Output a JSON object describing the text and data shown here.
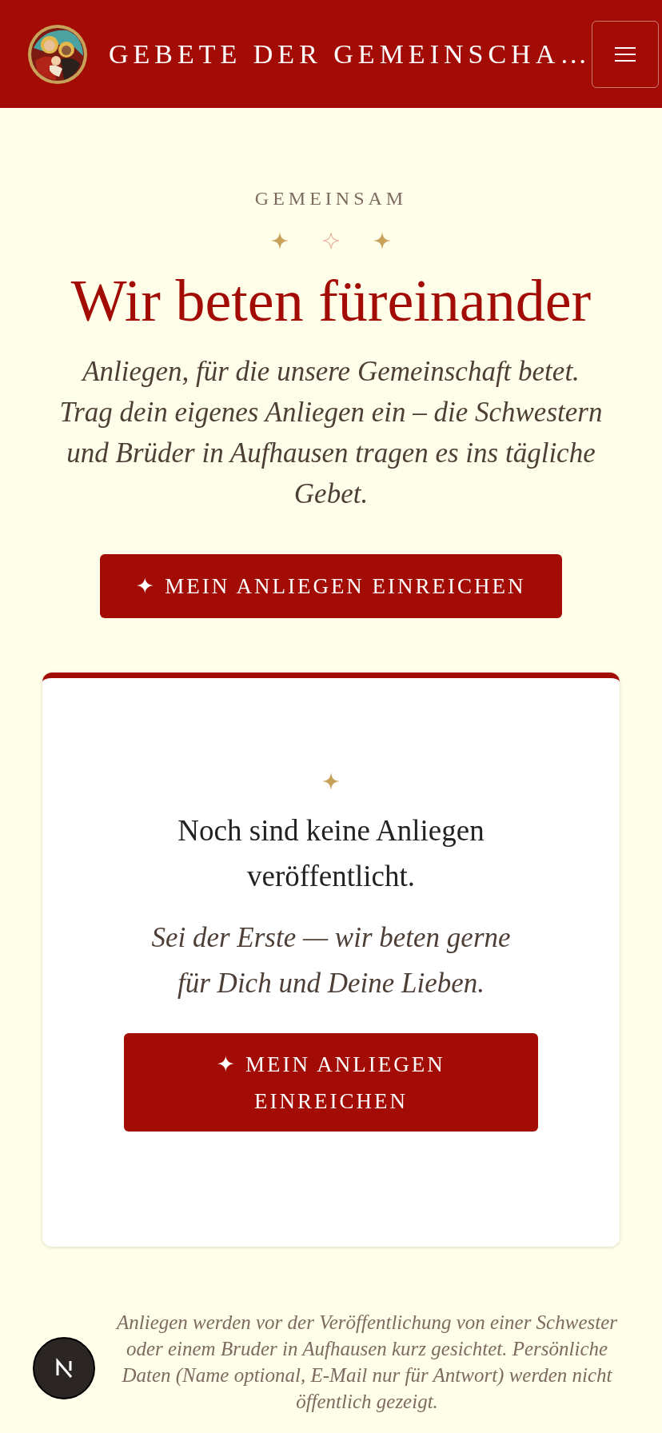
{
  "header": {
    "title": "GEBETE DER GEMEINSCHA…"
  },
  "intro": {
    "eyebrow": "GEMEINSAM",
    "title": "Wir beten füreinander",
    "text": "Anliegen, für die unsere Gemeinschaft betet. Trag dein eigenes Anliegen ein – die Schwestern und Brüder in Aufhausen tragen es ins tägliche Gebet.",
    "button": "✦ MEIN ANLIEGEN EINREICHEN"
  },
  "empty_card": {
    "heading": "Noch sind keine Anliegen veröffentlicht.",
    "text": "Sei der Erste — wir beten gerne für Dich und Deine Lieben.",
    "button": "✦ MEIN ANLIEGEN EINREICHEN"
  },
  "footnote": "Anliegen werden vor der Veröffentlichung von einer Schwester oder einem Bruder in Aufhausen kurz gesichtet. Persönliche Daten (Name optional, E-Mail nur für Antwort) werden nicht öffentlich gezeigt."
}
